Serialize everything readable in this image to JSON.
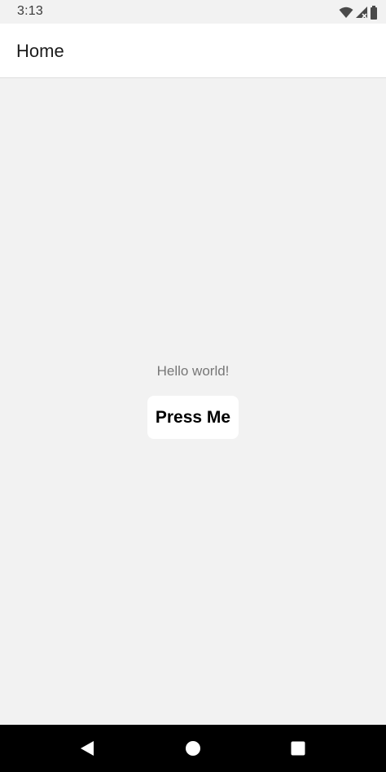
{
  "status_bar": {
    "time": "3:13",
    "icons": [
      "wifi-icon",
      "signal-icon",
      "battery-icon"
    ]
  },
  "app_bar": {
    "title": "Home"
  },
  "main": {
    "hello_text": "Hello world!",
    "button_label": "Press Me"
  },
  "nav_bar": {
    "buttons": [
      "back-icon",
      "home-icon",
      "recents-icon"
    ]
  },
  "colors": {
    "background": "#f2f2f2",
    "app_bar": "#ffffff",
    "nav_bar": "#000000",
    "hello_text": "#777777",
    "button_bg": "#ffffff"
  }
}
